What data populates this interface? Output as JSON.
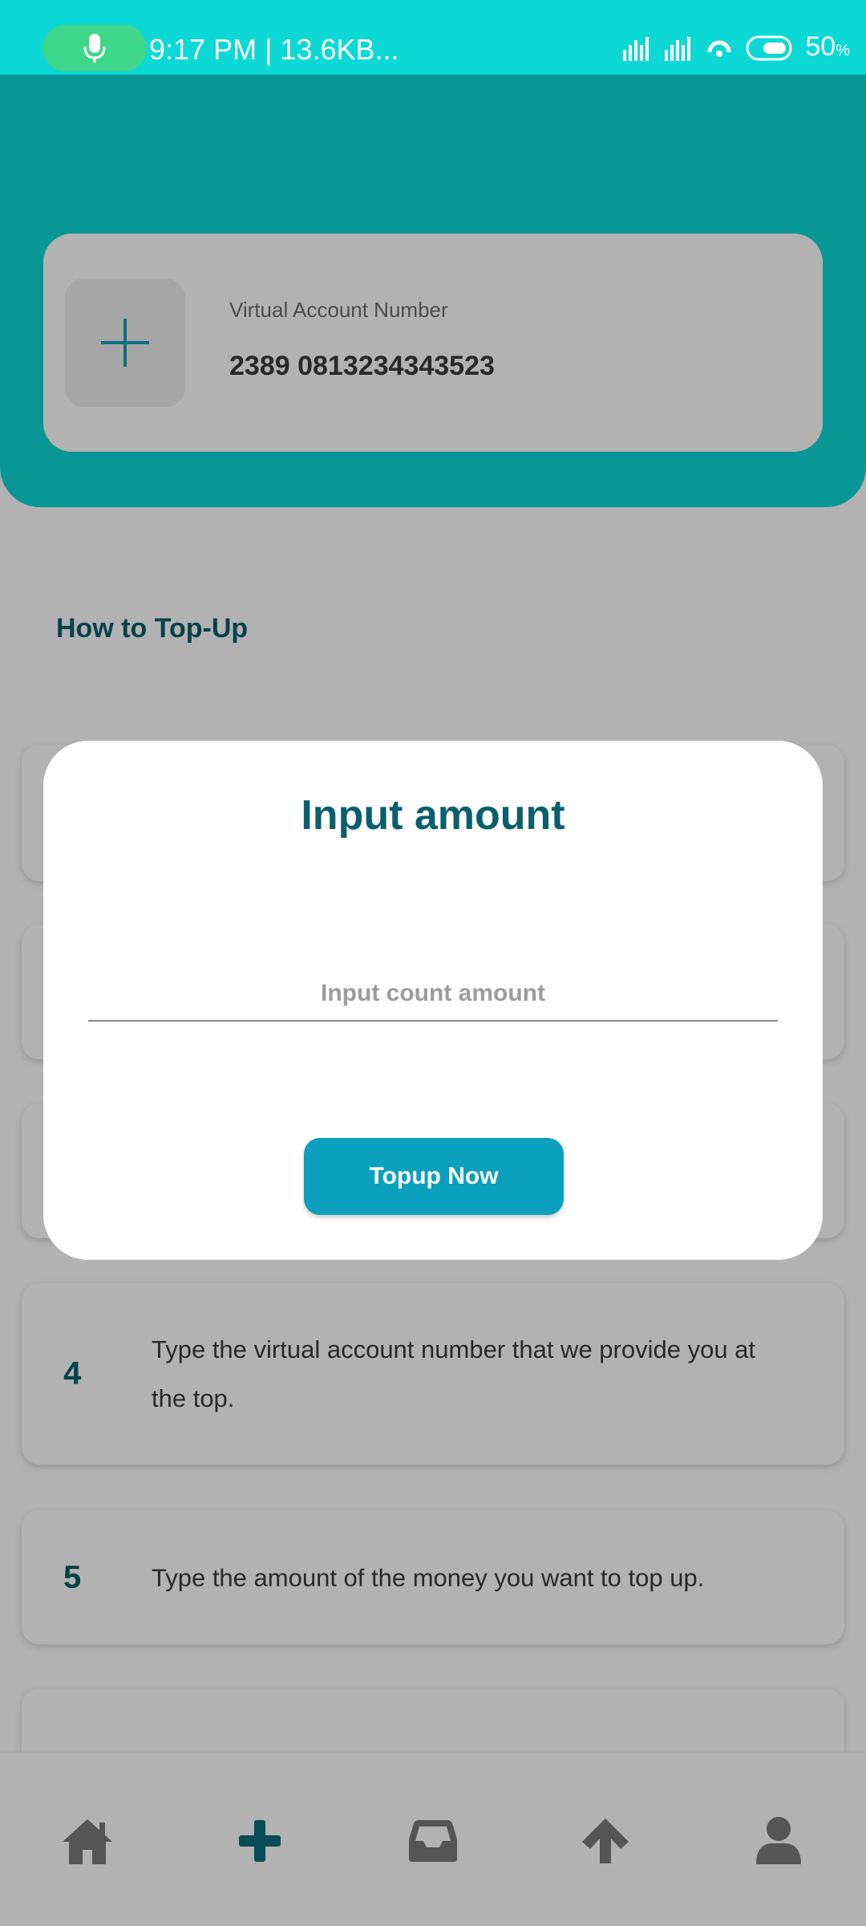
{
  "status_bar": {
    "time": "9:17 PM | 13.6KB...",
    "battery_value": "50",
    "battery_unit": "%"
  },
  "account": {
    "label": "Virtual Account Number",
    "number": "2389 0813234343523"
  },
  "section": {
    "title": "How to Top-Up"
  },
  "steps": [
    {
      "num": "4",
      "text": "Type the virtual account number that we provide you at the top."
    },
    {
      "num": "5",
      "text": "Type the amount of the money you want to top up."
    }
  ],
  "dialog": {
    "title": "Input amount",
    "input_placeholder": "Input count amount",
    "input_value": "",
    "button_label": "Topup Now"
  },
  "nav": {
    "items": [
      "home-icon",
      "plus-icon",
      "inbox-icon",
      "arrow-up-icon",
      "user-icon"
    ],
    "active": "plus-icon"
  },
  "colors": {
    "primary": "#0cd8d6",
    "accent": "#0a5f6d",
    "button": "#0ba0bd",
    "nav_active": "#0a6f7f",
    "nav_inactive": "#7a7a7a"
  }
}
